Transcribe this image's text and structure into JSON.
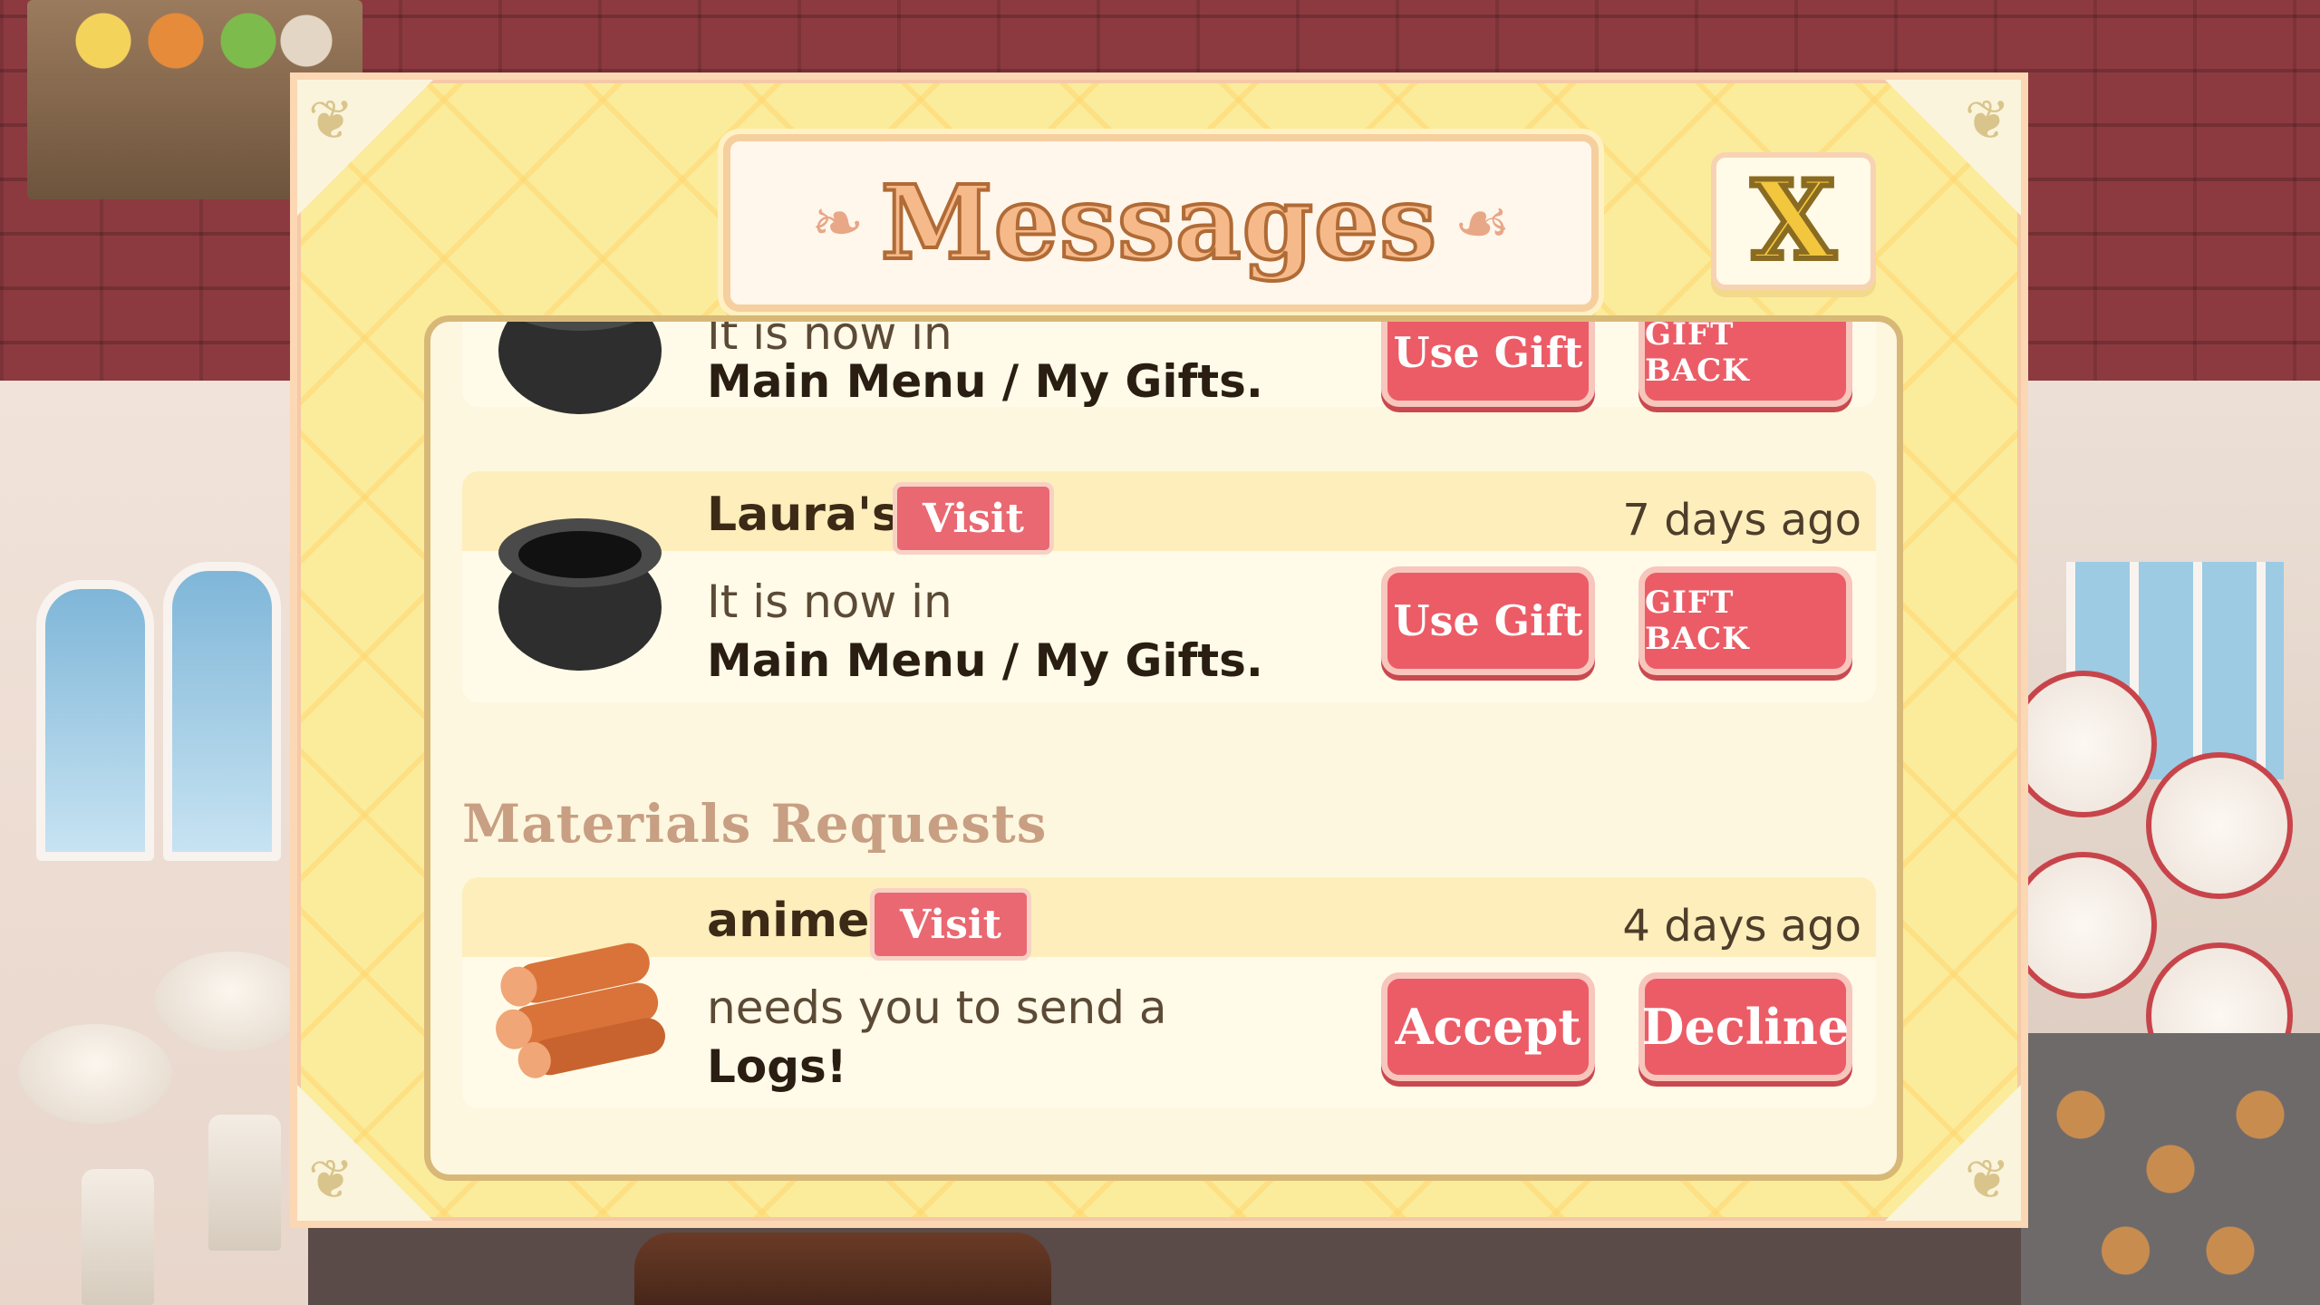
{
  "window": {
    "title": "Messages",
    "close_label": "X"
  },
  "messages": [
    {
      "sender": "",
      "visit_label": "",
      "time_ago": "",
      "line1": "It is now in",
      "line2": "Main Menu / My Gifts.",
      "item_icon": "pot-icon",
      "primary_action": "Use Gift",
      "secondary_action": "GIFT BACK"
    },
    {
      "sender": "Laura's",
      "visit_label": "Visit",
      "time_ago": "7 days ago",
      "line1": "It is now in",
      "line2": "Main Menu / My Gifts.",
      "item_icon": "pot-icon",
      "primary_action": "Use Gift",
      "secondary_action": "GIFT BACK"
    }
  ],
  "materials_section": {
    "title": "Materials Requests",
    "requests": [
      {
        "sender": "anime",
        "visit_label": "Visit",
        "time_ago": "4 days ago",
        "line1": "needs you to send a",
        "line2": "Logs!",
        "item_icon": "logs-icon",
        "accept_label": "Accept",
        "decline_label": "Decline"
      }
    ]
  },
  "colors": {
    "modal_bg": "#fbec9c",
    "button_red": "#ec5c66",
    "title_orange": "#f6b98a",
    "close_yellow": "#f2c63d"
  }
}
